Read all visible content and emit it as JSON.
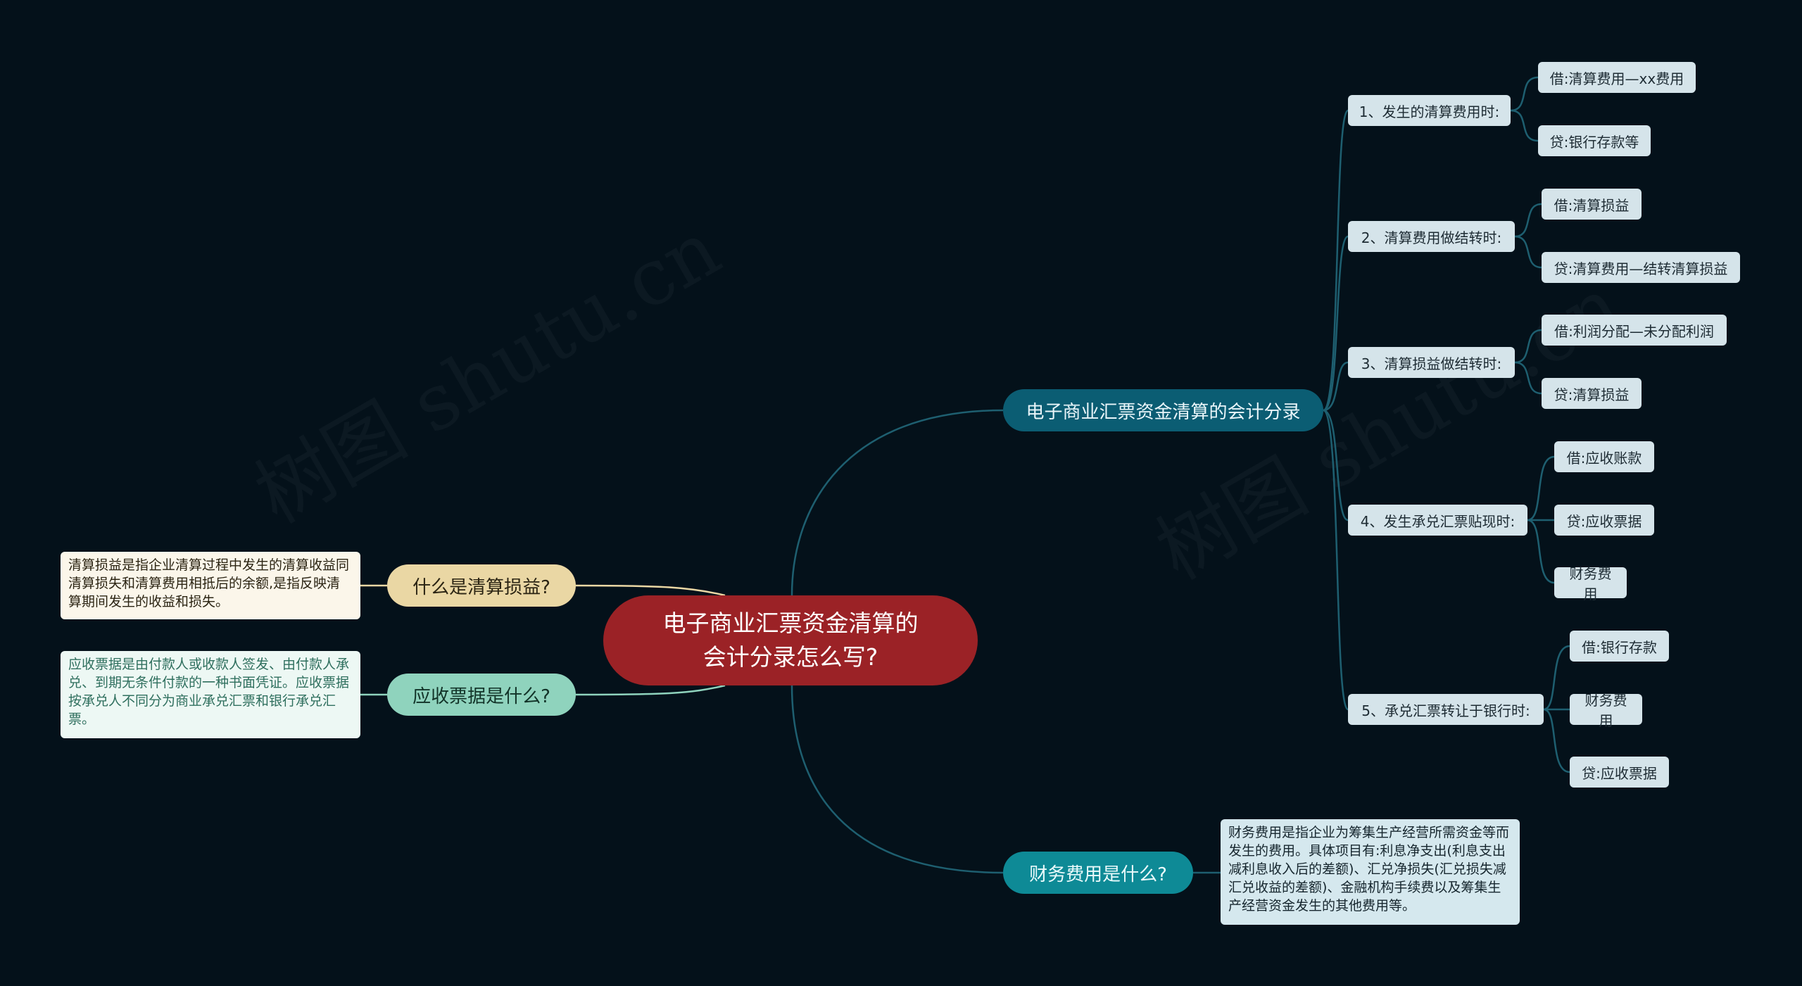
{
  "watermark": "树图 shutu.cn",
  "root": {
    "line1": "电子商业汇票资金清算的",
    "line2": "会计分录怎么写?"
  },
  "colors": {
    "background": "#04111a",
    "root": "#9b2226",
    "branch_right": "#0b5d73",
    "branch_caiwu": "#0e8a96",
    "branch_qingsuan": "#ead7a4",
    "branch_yingshou": "#8fd3bd",
    "line": "#1e5f70"
  },
  "right_branch": {
    "label": "电子商业汇票资金清算的会计分录",
    "steps": [
      {
        "label": "1、发生的清算费用时:",
        "items": [
          "借:清算费用—xx费用",
          "贷:银行存款等"
        ]
      },
      {
        "label": "2、清算费用做结转时:",
        "items": [
          "借:清算损益",
          "贷:清算费用—结转清算损益"
        ]
      },
      {
        "label": "3、清算损益做结转时:",
        "items": [
          "借:利润分配—未分配利润",
          "贷:清算损益"
        ]
      },
      {
        "label": "4、发生承兑汇票贴现时:",
        "items": [
          "借:应收账款",
          "贷:应收票据",
          "财务费用"
        ]
      },
      {
        "label": "5、承兑汇票转让于银行时:",
        "items": [
          "借:银行存款",
          "财务费用",
          "贷:应收票据"
        ]
      }
    ]
  },
  "caiwu_branch": {
    "label": "财务费用是什么?",
    "description": "财务费用是指企业为筹集生产经营所需资金等而发生的费用。具体项目有:利息净支出(利息支出减利息收入后的差额)、汇兑净损失(汇兑损失减汇兑收益的差额)、金融机构手续费以及筹集生产经营资金发生的其他费用等。"
  },
  "qingsuan_branch": {
    "label": "什么是清算损益?",
    "description": "清算损益是指企业清算过程中发生的清算收益同清算损失和清算费用相抵后的余额,是指反映清算期间发生的收益和损失。"
  },
  "yingshou_branch": {
    "label": "应收票据是什么?",
    "description": "应收票据是由付款人或收款人签发、由付款人承兑、到期无条件付款的一种书面凭证。应收票据按承兑人不同分为商业承兑汇票和银行承兑汇票。"
  }
}
